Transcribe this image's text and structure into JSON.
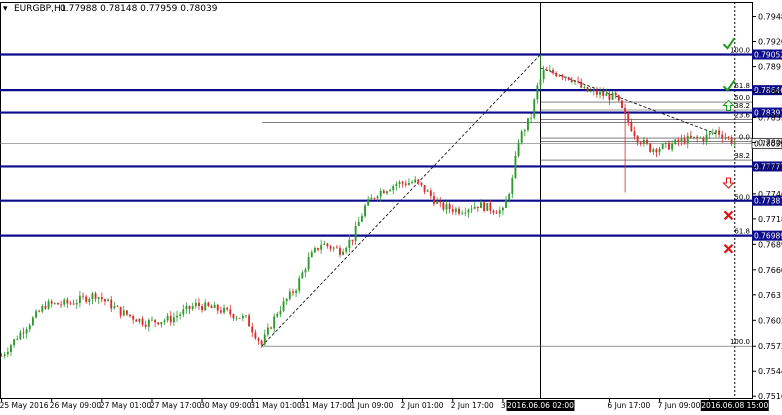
{
  "header": {
    "symbol": "EURGBP,H1",
    "ohlc": "0.77988 0.78148 0.77959 0.78039"
  },
  "colors": {
    "bull": "#2e9a2e",
    "bear": "#dd2a2a",
    "level": "#0b0b8c",
    "tag_bg": "#0b0b8c",
    "last_tag_bg": "#ffffff",
    "grid": "#000000",
    "check": "#1f9a1f",
    "cross": "#e01010"
  },
  "chart_data": {
    "type": "candlestick",
    "title": "EURGBP,H1",
    "ylim": [
      0.7514,
      0.7965
    ],
    "y_ticks": [
      "0.79485",
      "0.79200",
      "0.78915",
      "0.78630",
      "0.78335",
      "0.78050",
      "0.77765",
      "0.77465",
      "0.77180",
      "0.76890",
      "0.76600",
      "0.76315",
      "0.76025",
      "0.75730",
      "0.75445",
      "0.75160"
    ],
    "y_tick_values": [
      0.79485,
      0.792,
      0.78915,
      0.7863,
      0.78335,
      0.7805,
      0.77765,
      0.77465,
      0.7718,
      0.7689,
      0.766,
      0.76315,
      0.76025,
      0.7573,
      0.75445,
      0.7516
    ],
    "x_ticks": [
      "25 May 2016",
      "26 May 09:00",
      "27 May 01:00",
      "27 May 17:00",
      "30 May 09:00",
      "31 May 01:00",
      "31 May 17:00",
      "1 Jun 09:00",
      "2 Jun 01:00",
      "2 Jun 17:00",
      "3 Jun 09:00",
      "6 Jun 17:00",
      "7 Jun 09:00",
      "8 Ju"
    ],
    "x_tick_index": [
      0,
      16,
      32,
      48,
      64,
      80,
      96,
      112,
      128,
      144,
      160,
      194,
      210,
      226
    ],
    "x_highlights": [
      {
        "label": "2016.06.06 02:00",
        "index": 172
      },
      {
        "label": "2016.06.08 15:00",
        "index": 234
      }
    ],
    "levels": [
      {
        "value": 0.79052,
        "label": "0.79052"
      },
      {
        "value": 0.78646,
        "label": "0.78646"
      },
      {
        "value": 0.78391,
        "label": "0.78391"
      },
      {
        "value": 0.77777,
        "label": "0.77777"
      },
      {
        "value": 0.77387,
        "label": "0.77387"
      },
      {
        "value": 0.76989,
        "label": "0.76989"
      }
    ],
    "last_price": {
      "value": 0.78039,
      "label": "0.78039"
    },
    "fibo_main": {
      "levels": [
        {
          "label": "100.0",
          "value": 0.79052
        },
        {
          "label": "61.8",
          "value": 0.78646
        },
        {
          "label": "50.0",
          "value": 0.7738
        },
        {
          "label": "61.8",
          "value": 0.7699
        },
        {
          "label": "100.0",
          "value": 0.7573
        }
      ],
      "low_point": {
        "index": 83,
        "value": 0.7573
      },
      "high_point": {
        "index": 172,
        "value": 0.79052
      }
    },
    "fibo_small": {
      "levels": [
        {
          "label": "50.0",
          "value": 0.7851
        },
        {
          "label": "38.2",
          "value": 0.7842
        },
        {
          "label": "23.6",
          "value": 0.7831
        },
        {
          "label": "0.0",
          "value": 0.7806
        },
        {
          "label": "38.2",
          "value": 0.7785
        }
      ]
    },
    "signals": [
      {
        "kind": "check",
        "index": 232,
        "value": 0.7917
      },
      {
        "kind": "check",
        "index": 232,
        "value": 0.7869
      },
      {
        "kind": "arrow-up",
        "index": 232,
        "value": 0.7846
      },
      {
        "kind": "arrow-down",
        "index": 232,
        "value": 0.776
      },
      {
        "kind": "cross",
        "index": 232,
        "value": 0.7722
      },
      {
        "kind": "cross",
        "index": 232,
        "value": 0.7684
      }
    ],
    "anchors": [
      [
        0,
        0.7562
      ],
      [
        6,
        0.7588
      ],
      [
        14,
        0.762
      ],
      [
        22,
        0.7622
      ],
      [
        30,
        0.7632
      ],
      [
        38,
        0.7612
      ],
      [
        46,
        0.76
      ],
      [
        54,
        0.7604
      ],
      [
        62,
        0.762
      ],
      [
        70,
        0.7614
      ],
      [
        78,
        0.7604
      ],
      [
        83,
        0.7575
      ],
      [
        88,
        0.7612
      ],
      [
        94,
        0.764
      ],
      [
        98,
        0.7672
      ],
      [
        102,
        0.769
      ],
      [
        108,
        0.7682
      ],
      [
        112,
        0.7696
      ],
      [
        116,
        0.7732
      ],
      [
        120,
        0.7748
      ],
      [
        126,
        0.7758
      ],
      [
        132,
        0.776
      ],
      [
        136,
        0.7748
      ],
      [
        140,
        0.7732
      ],
      [
        146,
        0.7728
      ],
      [
        152,
        0.7734
      ],
      [
        156,
        0.773
      ],
      [
        160,
        0.7726
      ],
      [
        163,
        0.7762
      ],
      [
        165,
        0.7808
      ],
      [
        169,
        0.7835
      ],
      [
        171,
        0.7868
      ],
      [
        173,
        0.7885
      ],
      [
        178,
        0.7884
      ],
      [
        182,
        0.7878
      ],
      [
        186,
        0.7864
      ],
      [
        191,
        0.786
      ],
      [
        196,
        0.7856
      ],
      [
        199,
        0.7834
      ],
      [
        203,
        0.781
      ],
      [
        207,
        0.7798
      ],
      [
        212,
        0.78
      ],
      [
        218,
        0.7808
      ],
      [
        224,
        0.781
      ],
      [
        228,
        0.7818
      ],
      [
        231,
        0.7812
      ],
      [
        234,
        0.7804
      ]
    ],
    "spikes": [
      {
        "index": 172,
        "high": 0.79052
      },
      {
        "index": 199,
        "low": 0.7748
      }
    ]
  }
}
